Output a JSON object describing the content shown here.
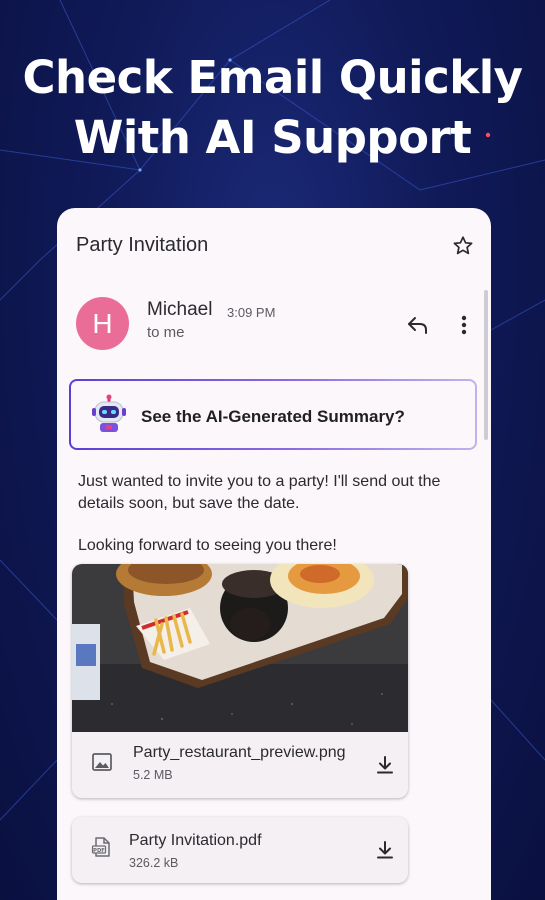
{
  "promo": {
    "headline_line1": "Check Email Quickly",
    "headline_line2": "With AI Support"
  },
  "email": {
    "subject": "Party Invitation",
    "sender": {
      "initial": "H",
      "name": "Michael",
      "time": "3:09 PM",
      "recipient": "to me"
    },
    "ai_summary_label": "See the AI-Generated Summary?",
    "body_paragraph_1": "Just wanted to invite you to a party! I'll send out the details soon, but save the date.",
    "body_paragraph_2": "Looking forward to seeing you there!",
    "attachments": [
      {
        "name": "Party_restaurant_preview.png",
        "size": "5.2 MB",
        "icon": "image-icon"
      },
      {
        "name": "Party Invitation.pdf",
        "size": "326.2 kB",
        "icon": "pdf-icon"
      }
    ]
  },
  "colors": {
    "background": "#101a58",
    "avatar": "#ea6d97",
    "ai_border_start": "#5a3fd6",
    "card": "#fbf7fb"
  },
  "icons": [
    "star-icon",
    "reply-icon",
    "more-vert-icon",
    "robot-icon",
    "image-icon",
    "pdf-icon",
    "download-icon"
  ]
}
